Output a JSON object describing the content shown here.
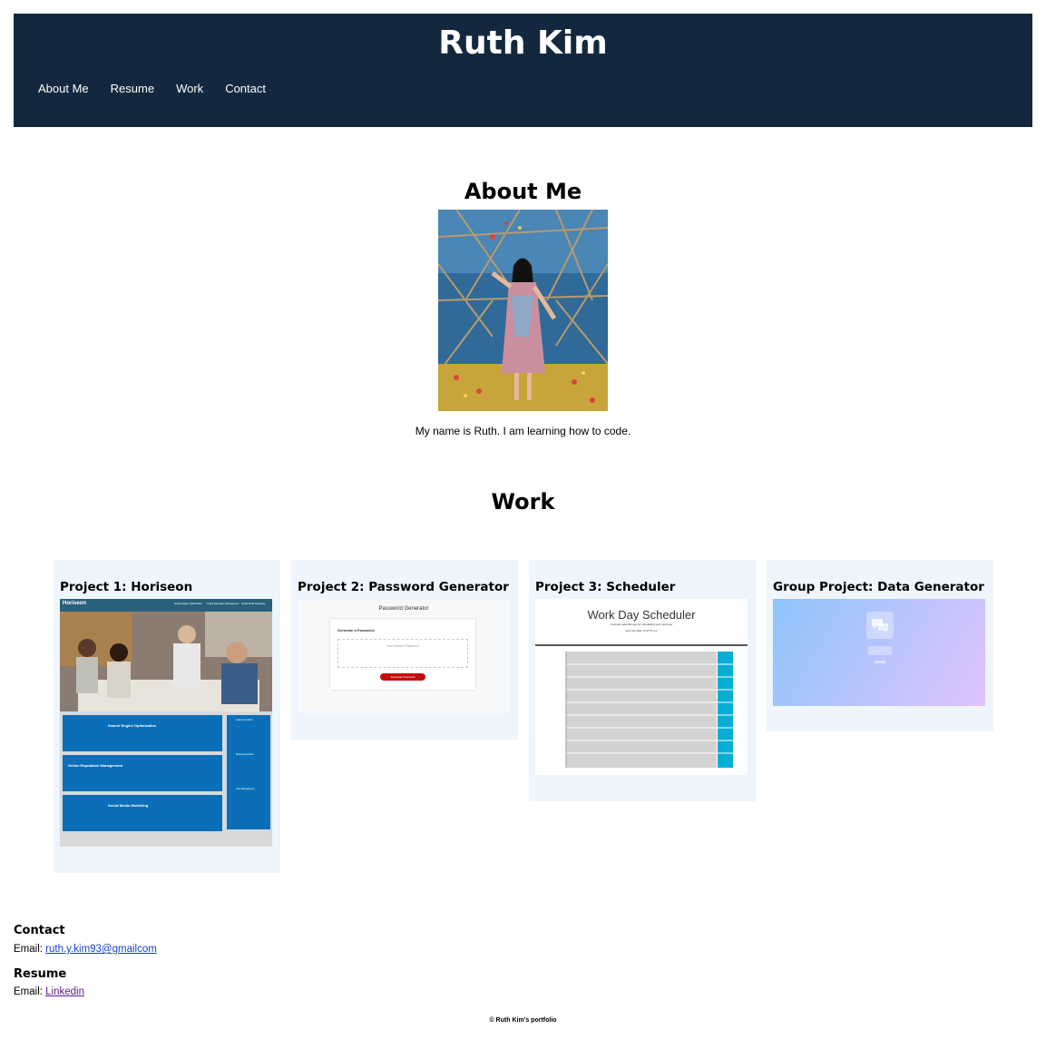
{
  "header": {
    "title": "Ruth Kim",
    "nav": [
      "About Me",
      "Resume",
      "Work",
      "Contact"
    ]
  },
  "about": {
    "heading": "About Me",
    "bio": "My name is Ruth. I am learning how to code."
  },
  "work": {
    "heading": "Work",
    "projects": [
      {
        "title": "Project 1: Horiseon"
      },
      {
        "title": "Project 2: Password Generator"
      },
      {
        "title": "Project 3: Scheduler"
      },
      {
        "title": "Group Project: Data Generator"
      }
    ]
  },
  "screenshots": {
    "horiseon": {
      "brand": "Horiseon",
      "nav": [
        "Search Engine Optimization",
        "Online Reputation Management",
        "Social Media Marketing"
      ],
      "sections": [
        "Search Engine Optimization",
        "Online Reputation Management",
        "Social Media Marketing"
      ],
      "side_headings": [
        "Lead Generation",
        "Brand Awareness",
        "Cost Management"
      ]
    },
    "password": {
      "title": "Password Generator",
      "subtitle": "Generate a Password",
      "placeholder": "Your Secure Password",
      "button": "Generate Password"
    },
    "scheduler": {
      "title": "Work Day Scheduler",
      "subtitle": "A simple calendar app for scheduling your work day",
      "date": "April 1st 2021, 8:47:07 pm"
    }
  },
  "contact": {
    "heading": "Contact",
    "email_label": "Email:",
    "email": "ruth.y.kim93@gmailcom"
  },
  "resume": {
    "heading": "Resume",
    "label": "Email:",
    "link": "Linkedin"
  },
  "footer": "© Ruth Kim's portfolio",
  "colors": {
    "header_bg": "#13283e",
    "card_bg": "#eef5fc",
    "link": "#1a3fd1",
    "visited_link": "#5a1a8c"
  }
}
